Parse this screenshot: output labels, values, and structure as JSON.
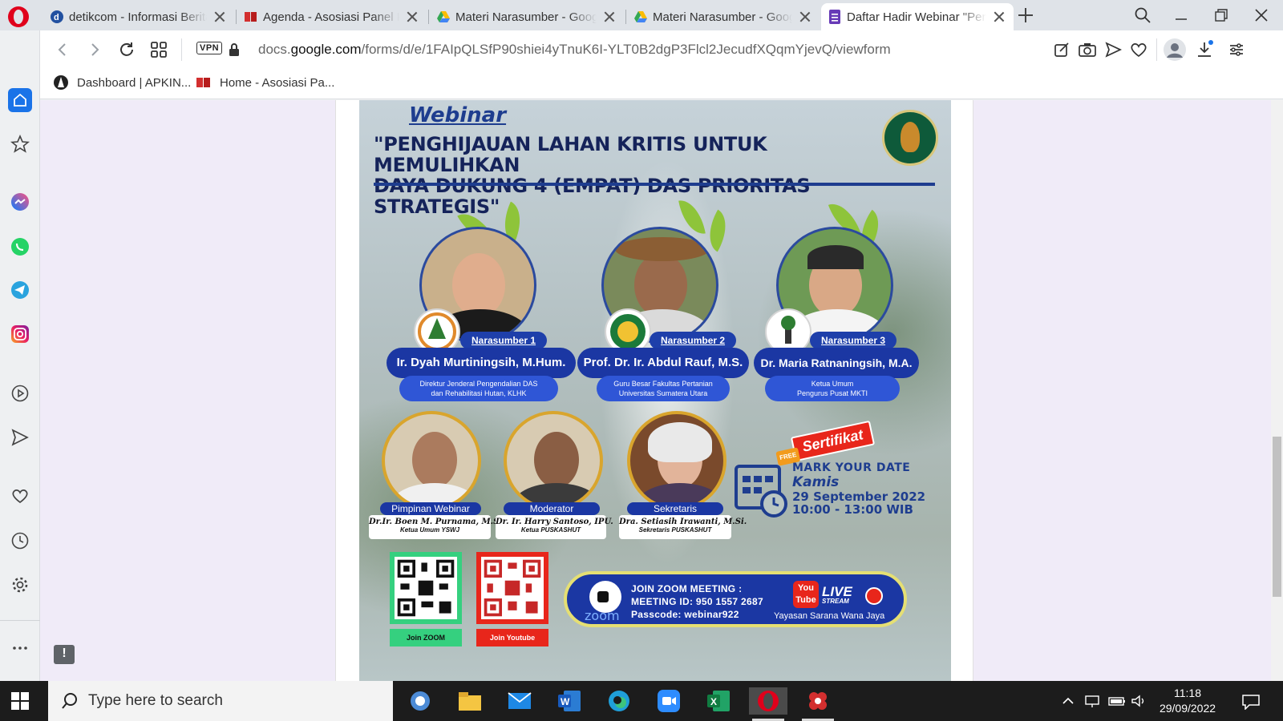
{
  "browser": {
    "tabs": [
      {
        "title": "detikcom - Informasi Berita",
        "favicon": "detik-icon",
        "active": false
      },
      {
        "title": "Agenda - Asosiasi Panel Ka",
        "favicon": "apkindo-icon",
        "active": false
      },
      {
        "title": "Materi Narasumber - Goog",
        "favicon": "google-drive-icon",
        "active": false
      },
      {
        "title": "Materi Narasumber - Goog",
        "favicon": "google-drive-icon",
        "active": false
      },
      {
        "title": "Daftar Hadir Webinar \"Peng",
        "favicon": "google-forms-icon",
        "active": true
      }
    ],
    "address": {
      "vpn_label": "VPN",
      "url_prefix": "docs.",
      "url_host": "google.com",
      "url_path": "/forms/d/e/1FAIpQLSfP90shiei4yTnuK6I-YLT0B2dgP3Flcl2JecudfXQqmYjevQ/viewform"
    },
    "bookmarks": [
      {
        "label": "Dashboard | APKIN...",
        "favicon": "apkin-icon"
      },
      {
        "label": "Home - Asosiasi Pa...",
        "favicon": "apkindo-icon"
      }
    ],
    "sidebar": [
      "home-icon",
      "bookmark-star-icon",
      "messenger-icon",
      "whatsapp-icon",
      "telegram-icon",
      "instagram-icon",
      "player-icon",
      "send-icon",
      "heart-icon",
      "history-icon",
      "settings-icon",
      "more-icon"
    ]
  },
  "poster": {
    "webinar_label": "Webinar",
    "title_line1": "\"PENGHIJAUAN LAHAN KRITIS UNTUK MEMULIHKAN",
    "title_line2": "DAYA DUKUNG 4 (EMPAT) DAS PRIORITAS STRATEGIS\"",
    "speakers": [
      {
        "tag": "Narasumber 1",
        "name": "Ir. Dyah Murtiningsih, M.Hum.",
        "role_line1": "Direktur Jenderal Pengendalian DAS",
        "role_line2": "dan Rehabilitasi Hutan, KLHK"
      },
      {
        "tag": "Narasumber 2",
        "name": "Prof. Dr. Ir. Abdul Rauf, M.S.",
        "role_line1": "Guru Besar Fakultas Pertanian",
        "role_line2": "Universitas Sumatera Utara"
      },
      {
        "tag": "Narasumber 3",
        "name": "Dr. Maria Ratnaningsih, M.A.",
        "role_line1": "Ketua Umum",
        "role_line2": "Pengurus Pusat  MKTI"
      }
    ],
    "panel": [
      {
        "role": "Pimpinan Webinar",
        "name": "Dr.Ir. Boen M. Purnama, M.Sc.",
        "sub": "Ketua Umum YSWJ"
      },
      {
        "role": "Moderator",
        "name": "Dr. Ir. Harry Santoso, IPU.",
        "sub": "Ketua PUSKASHUT"
      },
      {
        "role": "Sekretaris",
        "name": "Dra. Setiasih Irawanti, M.Si.",
        "sub": "Sekretaris PUSKASHUT"
      }
    ],
    "certificate": {
      "free": "FREE",
      "label": "Sertifikat"
    },
    "date": {
      "mark": "MARK YOUR DATE",
      "day": "Kamis",
      "date": "29 September 2022",
      "time": "10:00 - 13:00 WIB"
    },
    "qr": [
      {
        "label": "Join ZOOM",
        "color": "#35d07f"
      },
      {
        "label": "Join Youtube",
        "color": "#e8261b"
      }
    ],
    "zoom": {
      "line1": "JOIN ZOOM MEETING :",
      "line2": "MEETING ID: 950 1557 2687",
      "line3": "Passcode: webinar922",
      "brand": "zoom",
      "youtube_you": "You",
      "youtube_tube": "Tube",
      "live": "LIVE",
      "stream": "STREAM",
      "org": "Yayasan Sarana Wana Jaya"
    }
  },
  "taskbar": {
    "search_placeholder": "Type here to search",
    "time": "11:18",
    "date": "29/09/2022",
    "apps": [
      "outlook-icon",
      "file-explorer-icon",
      "mail-icon",
      "word-icon",
      "edge-icon",
      "zoom-icon",
      "excel-icon",
      "opera-icon",
      "flower-app-icon"
    ]
  },
  "colors": {
    "accent": "#1a73e8",
    "poster_blue": "#1b37a3",
    "forms_purple": "#673ab7"
  }
}
